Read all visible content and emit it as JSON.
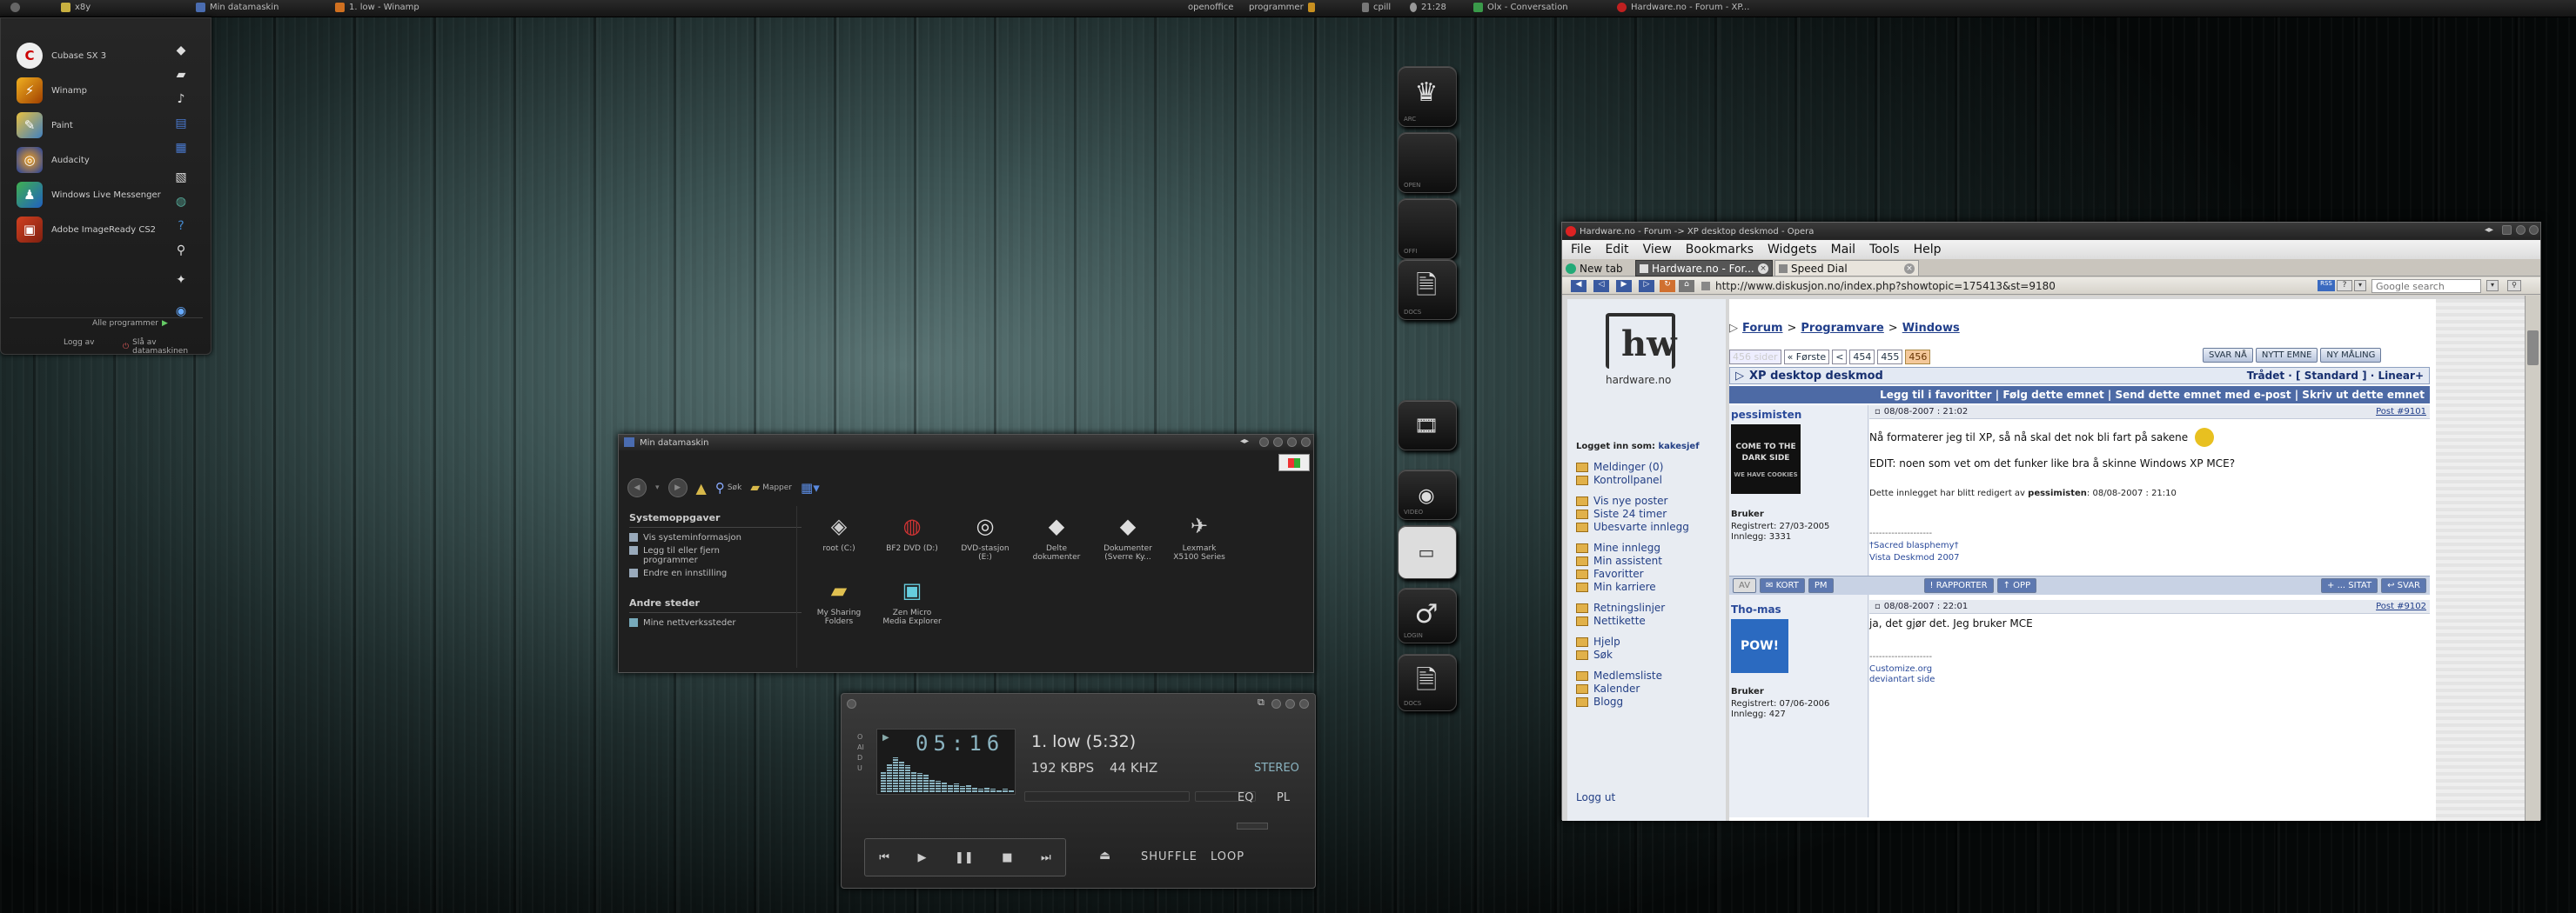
{
  "taskbar": {
    "items": [
      {
        "label": "x8y"
      },
      {
        "label": "Min datamaskin"
      },
      {
        "label": "1. low - Winamp"
      },
      {
        "label": "openoffice"
      },
      {
        "label": "programmer"
      },
      {
        "label": "cpill"
      },
      {
        "label": "21:28"
      },
      {
        "label": "Olx - Conversation"
      },
      {
        "label": "Hardware.no - Forum - XP..."
      }
    ]
  },
  "startmenu": {
    "apps": [
      {
        "label": "Cubase SX 3",
        "icon": "cubase-icon",
        "color": "#d01818"
      },
      {
        "label": "Winamp",
        "icon": "winamp-icon",
        "color": "#c07010"
      },
      {
        "label": "Paint",
        "icon": "paint-icon",
        "color": "#c8a020"
      },
      {
        "label": "Audacity",
        "icon": "audacity-icon",
        "color": "#2040a0"
      },
      {
        "label": "Windows Live Messenger",
        "icon": "messenger-icon",
        "color": "#2a8a3a"
      },
      {
        "label": "Adobe ImageReady CS2",
        "icon": "imageready-icon",
        "color": "#c03010"
      }
    ],
    "all_programs": "Alle programmer",
    "logoff": "Logg av",
    "shutdown": "Slå av datamaskinen"
  },
  "dock": {
    "labels": [
      "ARC",
      "OPEN",
      "OFFI",
      "DOCS",
      "",
      "VIDEO",
      "",
      "LOGIN",
      "DOCS"
    ]
  },
  "explorer": {
    "title": "Min datamaskin",
    "toolbar": {
      "back": "Tilbake",
      "search": "Søk",
      "folders": "Mapper"
    },
    "tasks_header": "Systemoppgaver",
    "tasks": [
      "Vis systeminformasjon",
      "Legg til eller fjern programmer",
      "Endre en innstilling"
    ],
    "other_header": "Andre steder",
    "other": [
      "Mine nettverkssteder"
    ],
    "items": [
      {
        "label": "root (C:)",
        "icon": "drive-icon"
      },
      {
        "label": "BF2 DVD (D:)",
        "icon": "dvd-icon"
      },
      {
        "label": "DVD-stasjon (E:)",
        "icon": "dvd-drive-icon"
      },
      {
        "label": "Delte dokumenter",
        "icon": "folder-icon"
      },
      {
        "label": "Dokumenter (Sverre Ky...",
        "icon": "folder-icon"
      },
      {
        "label": "Lexmark X5100 Series",
        "icon": "scanner-icon"
      },
      {
        "label": "My Sharing Folders",
        "icon": "sharing-folder-icon"
      },
      {
        "label": "Zen Micro Media Explorer",
        "icon": "media-player-icon"
      }
    ]
  },
  "winamp": {
    "side_label": "OAIDU",
    "time": "05:16",
    "track": "1. low (5:32)",
    "bitrate": "192 KBPS",
    "khz": "44 KHZ",
    "stereo": "STEREO",
    "eq": "EQ",
    "pl": "PL",
    "shuffle": "SHUFFLE",
    "loop": "LOOP",
    "vis_levels": [
      0.55,
      0.75,
      0.9,
      0.8,
      0.7,
      0.55,
      0.5,
      0.45,
      0.35,
      0.3,
      0.25,
      0.2,
      0.22,
      0.15,
      0.18,
      0.12,
      0.1,
      0.12,
      0.08,
      0.06,
      0.08,
      0.05
    ]
  },
  "opera": {
    "title": "Hardware.no - Forum -> XP desktop deskmod - Opera",
    "menu": [
      "File",
      "Edit",
      "View",
      "Bookmarks",
      "Widgets",
      "Mail",
      "Tools",
      "Help"
    ],
    "tabs": [
      {
        "label": "New tab"
      },
      {
        "label": "Hardware.no - For..."
      },
      {
        "label": "Speed Dial"
      }
    ],
    "url": "http://www.diskusjon.no/index.php?showtopic=175413&st=9180",
    "search_placeholder": "Google search",
    "logo_text": "hardware.no",
    "logged_in_label": "Logget inn som:",
    "username": "kakesjef",
    "sidebar_groups": [
      [
        "Meldinger (0)",
        "Kontrollpanel"
      ],
      [
        "Vis nye poster",
        "Siste 24 timer",
        "Ubesvarte innlegg"
      ],
      [
        "Mine innlegg",
        "Min assistent",
        "Favoritter",
        "Min karriere"
      ],
      [
        "Retningslinjer",
        "Nettikette"
      ],
      [
        "Hjelp",
        "Søk"
      ],
      [
        "Medlemsliste",
        "Kalender",
        "Blogg"
      ]
    ],
    "logout": "Logg ut",
    "breadcrumb": [
      "Forum",
      "Programvare",
      "Windows"
    ],
    "pages": [
      "456 sider",
      "« Første",
      "<",
      "454",
      "455",
      "456"
    ],
    "action_buttons": [
      "SVAR NÅ",
      "NYTT EMNE",
      "NY MÅLING"
    ],
    "topic_title": "XP desktop deskmod",
    "thread_mode": "Trådet · [ Standard ] · Linear+",
    "topic_actions": "Legg til i favoritter | Følg dette emnet | Send dette emnet med e-post | Skriv ut dette emnet",
    "posts": [
      {
        "author": "pessimisten",
        "date": "08/08-2007 : 21:02",
        "post_no": "Post #9101",
        "avatar_text": "COME TO THE DARK SIDE",
        "avatar_sub": "WE HAVE COOKIES",
        "role": "Bruker",
        "registered": "Registrert: 27/03-2005",
        "count": "Innlegg: 3331",
        "body": "Nå formaterer jeg til XP, så nå skal det nok bli fart på sakene",
        "body2": "EDIT: noen som vet om det funker like bra å skinne Windows XP MCE?",
        "edit_prefix": "Dette innlegget har blitt redigert av",
        "edit_user": "pessimisten",
        "edit_time": ": 08/08-2007 : 21:10",
        "sig1": "--------------------",
        "sig2": "†Sacred blasphemy†",
        "sig3": "Vista Deskmod 2007",
        "footer_left": [
          "AV",
          "✉ KORT",
          "PM"
        ],
        "footer_mid": [
          "! RAPPORTER",
          "↑ OPP"
        ],
        "footer_right": [
          "+ ... SITAT",
          "↩ SVAR"
        ]
      },
      {
        "author": "Tho-mas",
        "date": "08/08-2007 : 22:01",
        "post_no": "Post #9102",
        "avatar_text": "POW!",
        "role": "Bruker",
        "registered": "Registrert: 07/06-2006",
        "count": "Innlegg: 427",
        "body": "ja, det gjør det. Jeg bruker MCE",
        "sig1": "--------------------",
        "sig2": "Customize.org",
        "sig3": "deviantart side"
      }
    ]
  }
}
